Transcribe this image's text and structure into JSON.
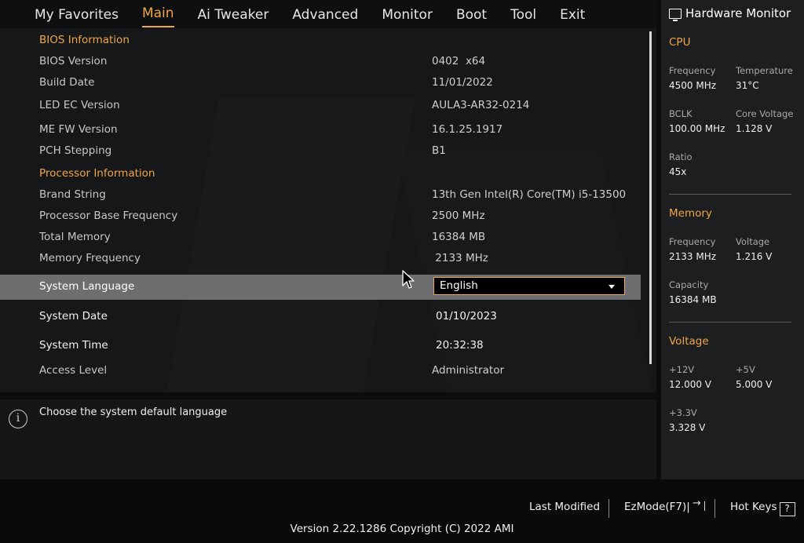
{
  "menu": {
    "items": [
      {
        "label": "My Favorites",
        "active": false
      },
      {
        "label": "Main",
        "active": true
      },
      {
        "label": "Ai Tweaker",
        "active": false
      },
      {
        "label": "Advanced",
        "active": false
      },
      {
        "label": "Monitor",
        "active": false
      },
      {
        "label": "Boot",
        "active": false
      },
      {
        "label": "Tool",
        "active": false
      },
      {
        "label": "Exit",
        "active": false
      }
    ]
  },
  "main": {
    "bios_info_heading": "BIOS Information",
    "bios_version": {
      "label": "BIOS Version",
      "value": "0402  x64"
    },
    "build_date": {
      "label": "Build Date",
      "value": "11/01/2022"
    },
    "led_ec_version": {
      "label": "LED EC Version",
      "value": "AULA3-AR32-0214"
    },
    "me_fw_version": {
      "label": "ME FW Version",
      "value": "16.1.25.1917"
    },
    "pch_stepping": {
      "label": "PCH Stepping",
      "value": "B1"
    },
    "processor_info_heading": "Processor Information",
    "brand_string": {
      "label": "Brand String",
      "value": "13th Gen Intel(R) Core(TM) i5-13500"
    },
    "base_frequency": {
      "label": "Processor Base Frequency",
      "value": "2500 MHz"
    },
    "total_memory": {
      "label": "Total Memory",
      "value": "16384 MB"
    },
    "memory_frequency": {
      "label": "Memory Frequency",
      "value": " 2133 MHz"
    },
    "system_language": {
      "label": "System Language",
      "value": "English"
    },
    "system_date": {
      "label": "System Date",
      "value": "01/10/2023"
    },
    "system_time": {
      "label": "System Time",
      "value": "20:32:38"
    },
    "access_level": {
      "label": "Access Level",
      "value": "Administrator"
    }
  },
  "help": {
    "text": "Choose the system default language",
    "icon": "info-icon"
  },
  "hardware_monitor": {
    "title": "Hardware Monitor",
    "cpu": {
      "heading": "CPU",
      "frequency_label": "Frequency",
      "frequency_value": "4500 MHz",
      "temperature_label": "Temperature",
      "temperature_value": "31°C",
      "bclk_label": "BCLK",
      "bclk_value": "100.00 MHz",
      "core_voltage_label": "Core Voltage",
      "core_voltage_value": "1.128 V",
      "ratio_label": "Ratio",
      "ratio_value": "45x"
    },
    "memory": {
      "heading": "Memory",
      "frequency_label": "Frequency",
      "frequency_value": "2133 MHz",
      "voltage_label": "Voltage",
      "voltage_value": "1.216 V",
      "capacity_label": "Capacity",
      "capacity_value": "16384 MB"
    },
    "voltage": {
      "heading": "Voltage",
      "v12_label": "+12V",
      "v12_value": "12.000 V",
      "v5_label": "+5V",
      "v5_value": "5.000 V",
      "v33_label": "+3.3V",
      "v33_value": "3.328 V"
    }
  },
  "footer": {
    "last_modified": "Last Modified",
    "ezmode": "EzMode(F7)|",
    "hot_keys": "Hot Keys",
    "hot_keys_badge": "?",
    "version": "Version 2.22.1286 Copyright (C) 2022 AMI"
  },
  "colors": {
    "accent": "#f0a64a",
    "highlight_row": "#6d6e70",
    "panel": "#151718",
    "monitor_panel": "#1c1e20"
  }
}
